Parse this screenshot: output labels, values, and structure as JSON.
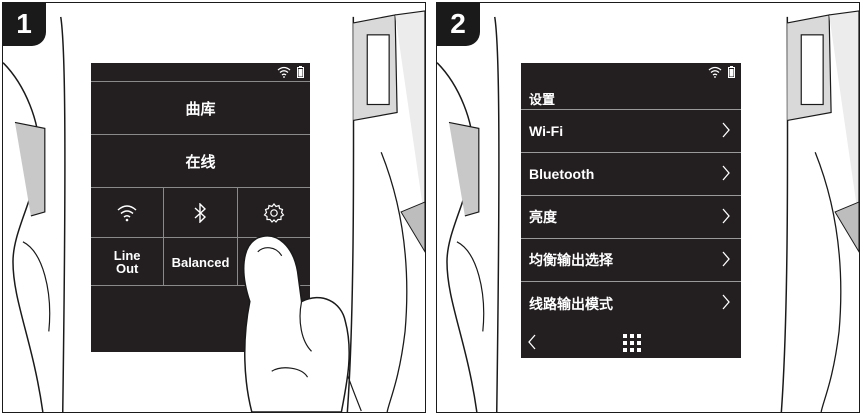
{
  "steps": [
    {
      "badge": "1"
    },
    {
      "badge": "2"
    }
  ],
  "screen1": {
    "tiles_big": [
      "曲库",
      "在线"
    ],
    "icon_row": [
      "wifi-icon",
      "bluetooth-icon",
      "gear-icon"
    ],
    "bottom_row": [
      "Line\nOut",
      "Balanced",
      ""
    ]
  },
  "screen2": {
    "title": "设置",
    "items": [
      "Wi-Fi",
      "Bluetooth",
      "亮度",
      "均衡输出选择",
      "线路输出模式"
    ]
  }
}
